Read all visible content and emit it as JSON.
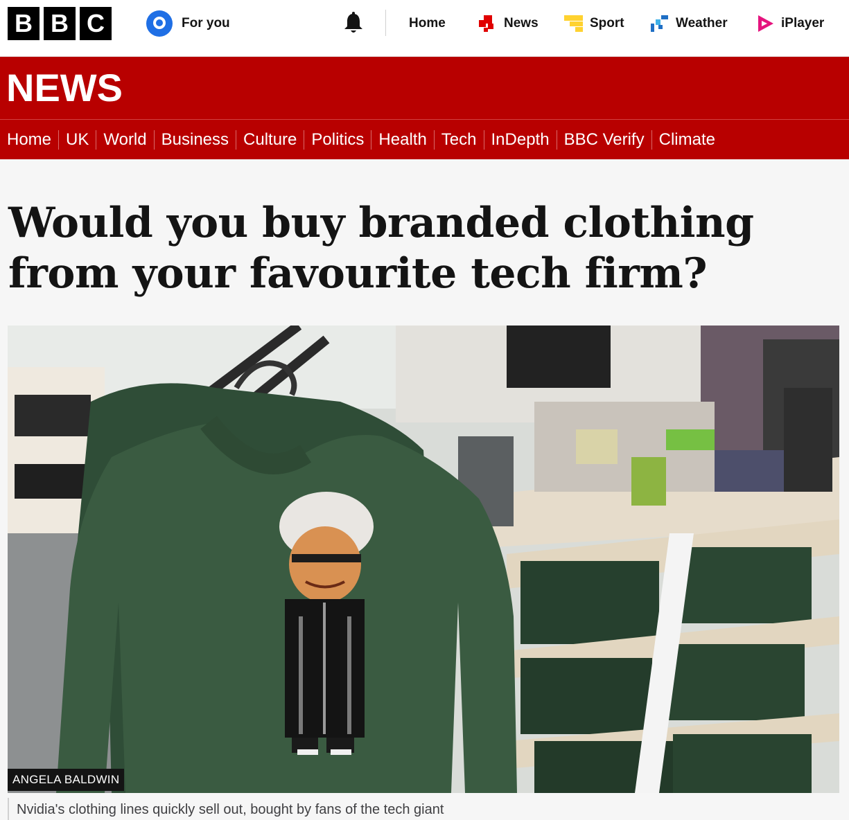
{
  "brand": {
    "logo_letters": [
      "B",
      "B",
      "C"
    ]
  },
  "topbar": {
    "foryou_label": "For you",
    "nav": [
      {
        "label": "Home",
        "icon": "none"
      },
      {
        "label": "News",
        "icon": "news-icon",
        "color": "#e00000"
      },
      {
        "label": "Sport",
        "icon": "sport-icon",
        "color": "#ffd230"
      },
      {
        "label": "Weather",
        "icon": "weather-icon",
        "color": "#1f6fc5"
      },
      {
        "label": "iPlayer",
        "icon": "iplayer-icon",
        "color": "#e5147e"
      }
    ]
  },
  "news_band": {
    "title": "NEWS",
    "color": "#b80000"
  },
  "section_nav": [
    "Home",
    "UK",
    "World",
    "Business",
    "Culture",
    "Politics",
    "Health",
    "Tech",
    "InDepth",
    "BBC Verify",
    "Climate"
  ],
  "article": {
    "headline": "Would you buy branded clothing from your favourite tech firm?",
    "image_credit": "ANGELA BALDWIN",
    "caption": "Nvidia's clothing lines quickly sell out, bought by fans of the tech giant"
  }
}
